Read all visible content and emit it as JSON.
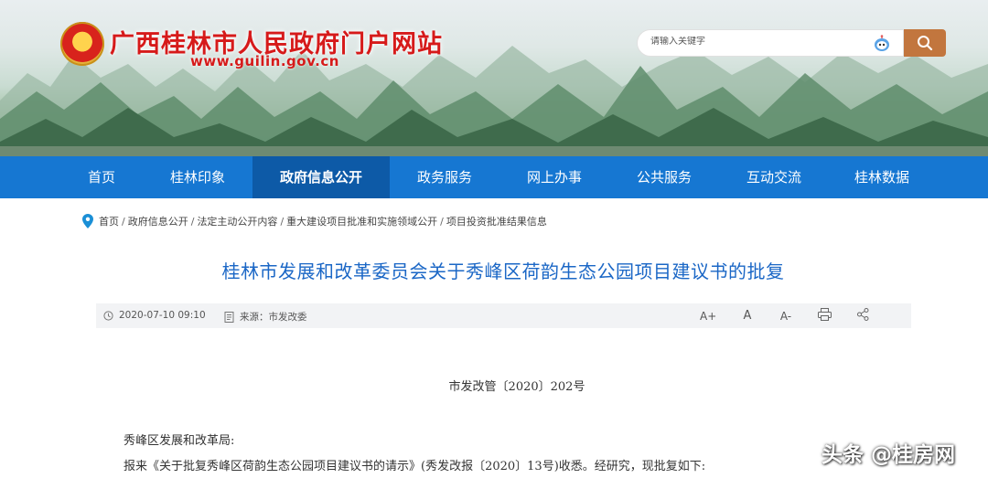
{
  "header": {
    "site_title": "广西桂林市人民政府门户网站",
    "site_url": "www.guilin.gov.cn",
    "search_placeholder": "请输入关键字"
  },
  "nav": {
    "items": [
      {
        "label": "首页"
      },
      {
        "label": "桂林印象"
      },
      {
        "label": "政府信息公开",
        "active": true
      },
      {
        "label": "政务服务"
      },
      {
        "label": "网上办事"
      },
      {
        "label": "公共服务"
      },
      {
        "label": "互动交流"
      },
      {
        "label": "桂林数据"
      }
    ]
  },
  "breadcrumb": [
    "首页",
    "政府信息公开",
    "法定主动公开内容",
    "重大建设项目批准和实施领域公开",
    "项目投资批准结果信息"
  ],
  "article": {
    "title": "桂林市发展和改革委员会关于秀峰区荷韵生态公园项目建议书的批复",
    "date": "2020-07-10 09:10",
    "source": "来源：市发改委",
    "doc_number": "市发改管〔2020〕202号",
    "addressee": "秀峰区发展和改革局:",
    "para1": "报来《关于批复秀峰区荷韵生态公园项目建议书的请示》(秀发改报〔2020〕13号)收悉。经研究，现批复如下:"
  },
  "tools": {
    "increase_font": "A+",
    "normal_font": "A",
    "decrease_font": "A-"
  },
  "watermark": "头条 @桂房网",
  "colors": {
    "nav_bg": "#1677d2",
    "nav_active": "#0d5aa7",
    "title_blue": "#1b67c6",
    "site_red": "#d61a1a",
    "search_btn": "#c2763e"
  }
}
